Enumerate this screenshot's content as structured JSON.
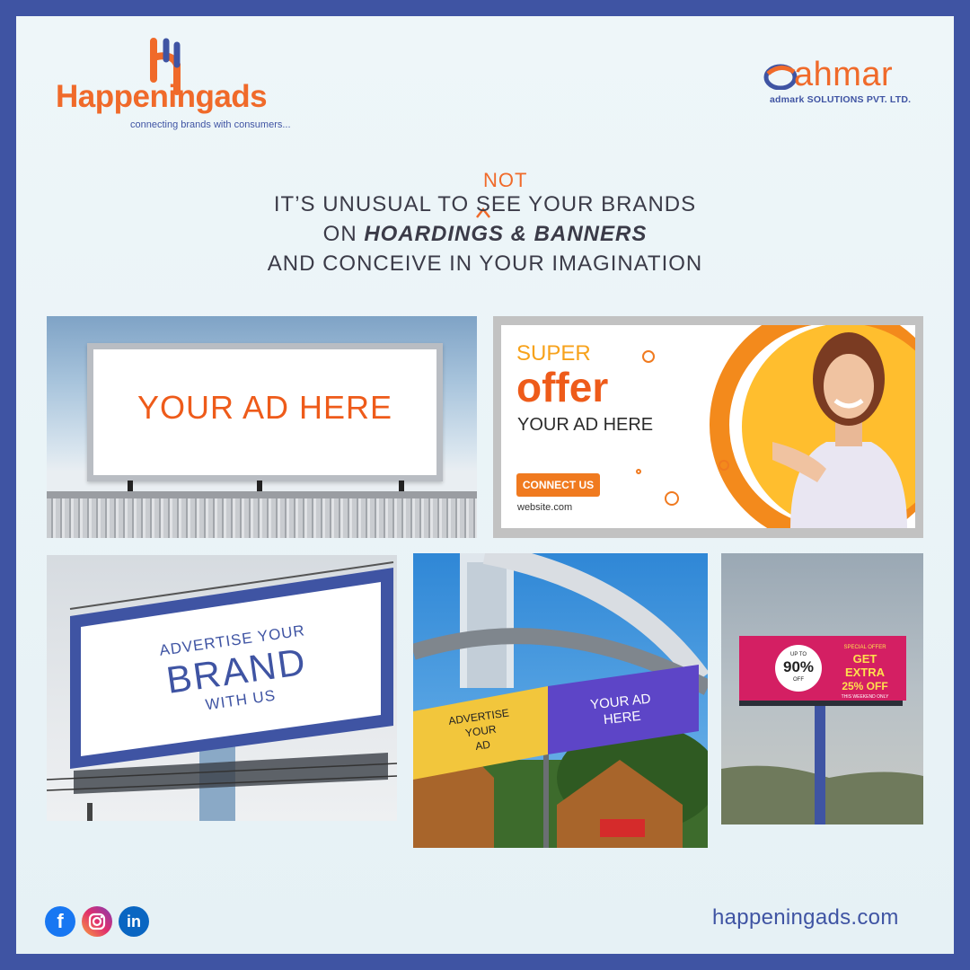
{
  "brand": {
    "name_part1": "Happening",
    "name_part2": "ads",
    "tagline": "connecting brands with consumers..."
  },
  "partner": {
    "name": "ahmar",
    "subtitle": "admark SOLUTIONS PVT. LTD."
  },
  "headline": {
    "insert_word": "NOT",
    "line1": "IT’S UNUSUAL TO   SEE YOUR BRANDS",
    "line2_prefix": "ON ",
    "line2_emphasis": "HOARDINGS & BANNERS",
    "line3": "AND CONCEIVE IN YOUR IMAGINATION"
  },
  "panels": {
    "billboard1": {
      "text": "YOUR AD HERE"
    },
    "banner": {
      "super": "SUPER",
      "offer": "offer",
      "ad_text": "YOUR AD HERE",
      "button": "CONNECT US",
      "website": "website.com"
    },
    "billboard3": {
      "line1": "ADVERTISE YOUR",
      "line2": "BRAND",
      "line3": "WITH US"
    },
    "billboard4": {
      "left_l1": "ADVERTISE",
      "left_l2": "YOUR",
      "left_l3": "AD",
      "right_l1": "YOUR AD",
      "right_l2": "HERE"
    },
    "billboard5": {
      "badge_top": "UP TO",
      "badge_value": "90%",
      "badge_bottom": "OFF",
      "special": "SPECIAL OFFER",
      "get": "GET",
      "extra": "EXTRA",
      "off": "25% OFF",
      "weekend": "THIS WEEKEND ONLY"
    }
  },
  "footer": {
    "social": [
      "facebook-icon",
      "instagram-icon",
      "linkedin-icon"
    ],
    "facebook_glyph": "f",
    "linkedin_glyph": "in",
    "website": "happeningads.com"
  },
  "colors": {
    "brand_orange": "#f06a2a",
    "brand_blue": "#3f54a3",
    "frame": "#3f54a3"
  }
}
